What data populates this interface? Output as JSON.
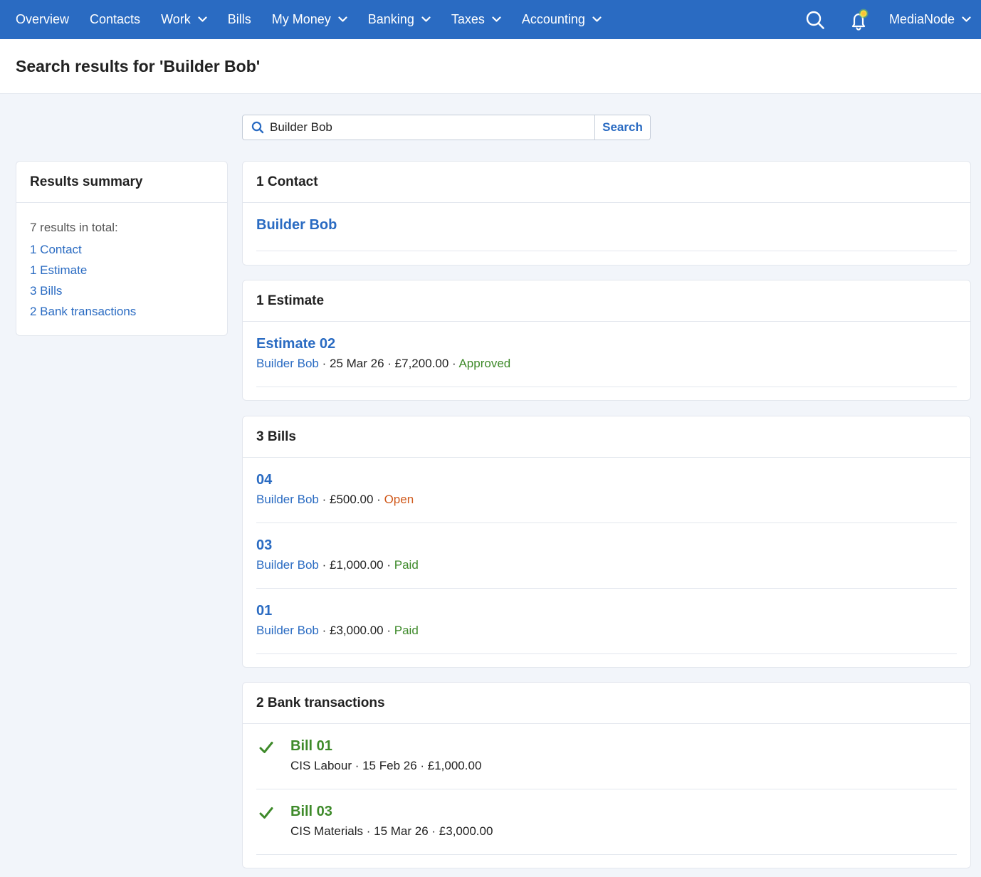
{
  "nav": {
    "items": [
      {
        "label": "Overview",
        "dropdown": false
      },
      {
        "label": "Contacts",
        "dropdown": false
      },
      {
        "label": "Work",
        "dropdown": true
      },
      {
        "label": "Bills",
        "dropdown": false
      },
      {
        "label": "My Money",
        "dropdown": true
      },
      {
        "label": "Banking",
        "dropdown": true
      },
      {
        "label": "Taxes",
        "dropdown": true
      },
      {
        "label": "Accounting",
        "dropdown": true
      }
    ],
    "account": "MediaNode",
    "icons": [
      "search-icon",
      "bell-notification-icon",
      "chevron-down-icon"
    ]
  },
  "page": {
    "title": "Search results for 'Builder Bob'"
  },
  "search": {
    "value": "Builder Bob",
    "button_label": "Search"
  },
  "summary": {
    "heading": "Results summary",
    "intro": "7 results in total:",
    "links": [
      "1 Contact",
      "1 Estimate",
      "3 Bills",
      "2 Bank transactions"
    ]
  },
  "contacts": {
    "heading": "1 Contact",
    "items": [
      {
        "name": "Builder Bob"
      }
    ]
  },
  "estimates": {
    "heading": "1 Estimate",
    "items": [
      {
        "title": "Estimate 02",
        "contact": "Builder Bob",
        "date": "25 Mar 26",
        "amount": "£7,200.00",
        "status": "Approved"
      }
    ]
  },
  "bills": {
    "heading": "3 Bills",
    "items": [
      {
        "title": "04",
        "contact": "Builder Bob",
        "amount": "£500.00",
        "status": "Open"
      },
      {
        "title": "03",
        "contact": "Builder Bob",
        "amount": "£1,000.00",
        "status": "Paid"
      },
      {
        "title": "01",
        "contact": "Builder Bob",
        "amount": "£3,000.00",
        "status": "Paid"
      }
    ]
  },
  "bank": {
    "heading": "2 Bank transactions",
    "items": [
      {
        "title": "Bill 01",
        "meta": "CIS Labour · 15 Feb 26 · £1,000.00"
      },
      {
        "title": "Bill 03",
        "meta": "CIS Materials · 15 Mar 26 · £3,000.00"
      }
    ]
  },
  "colors": {
    "nav_bg": "#2a6bc2",
    "link": "#2a6bc2",
    "status_green": "#3e8a2a",
    "status_orange": "#d0591b",
    "page_bg": "#f2f5fa"
  },
  "sep": " · "
}
